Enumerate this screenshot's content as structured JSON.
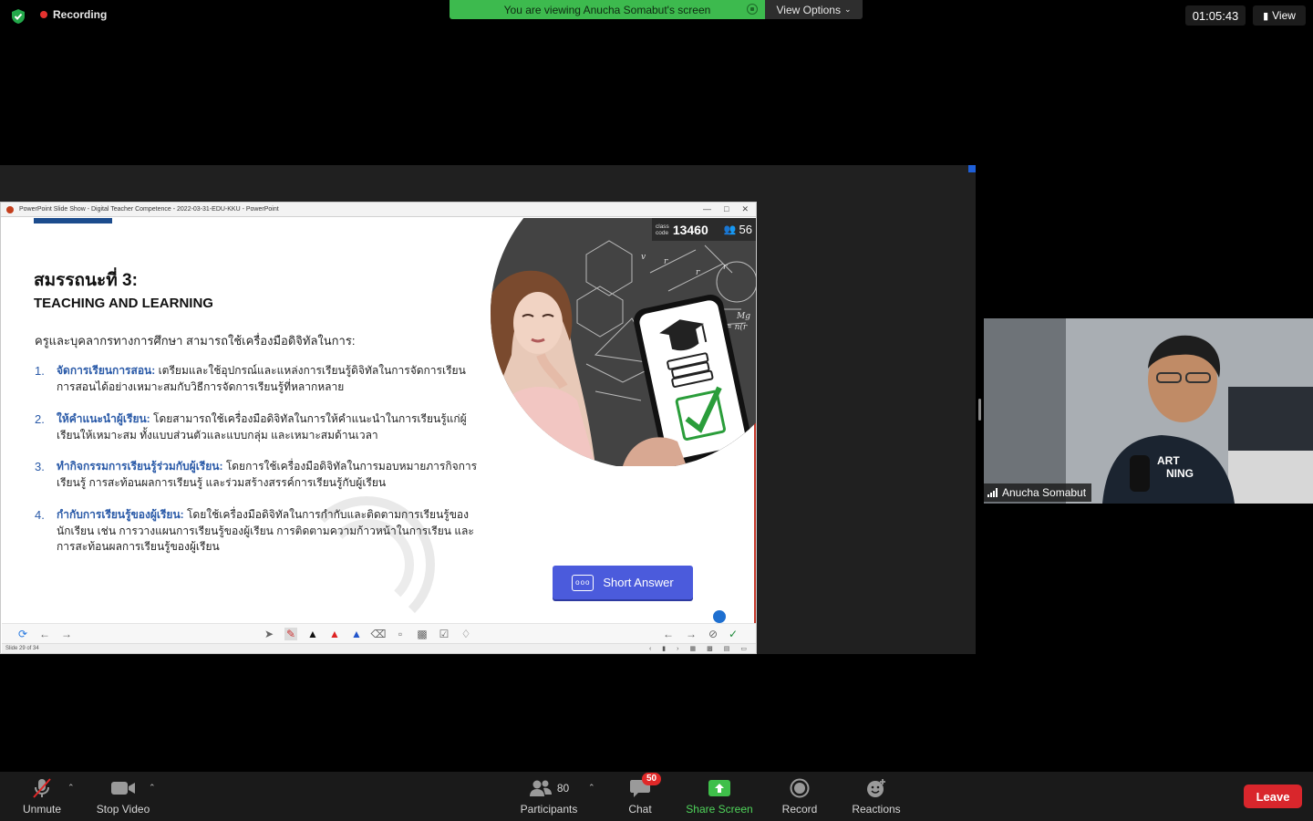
{
  "topbar": {
    "recording_label": "Recording",
    "viewing_banner": "You are viewing Anucha Somabut's screen",
    "view_options_label": "View Options",
    "timer": "01:05:43",
    "view_label": "View"
  },
  "ppt": {
    "window_title": "PowerPoint Slide Show  -  Digital Teacher Competence - 2022-03-31-EDU-KKU  -  PowerPoint",
    "status_text": "Slide 29 of 34"
  },
  "slide": {
    "title": "สมรรถนะที่ 3:",
    "subtitle": "TEACHING AND LEARNING",
    "intro": "ครูและบุคลากรทางการศึกษา สามารถใช้เครื่องมือดิจิทัลในการ:",
    "items": [
      {
        "num": "1.",
        "head": "จัดการเรียนการสอน:",
        "text": " เตรียมและใช้อุปกรณ์และแหล่งการเรียนรู้ดิจิทัลในการจัดการเรียนการสอนได้อย่างเหมาะสมกับวิธีการจัดการเรียนรู้ที่หลากหลาย"
      },
      {
        "num": "2.",
        "head": "ให้คำแนะนำผู้เรียน:",
        "text": " โดยสามารถใช้เครื่องมือดิจิทัลในการให้คำแนะนำในการเรียนรู้แก่ผู้เรียนให้เหมาะสม ทั้งแบบส่วนตัวและแบบกลุ่ม และเหมาะสมด้านเวลา"
      },
      {
        "num": "3.",
        "head": "ทำกิจกรรมการเรียนรู้ร่วมกับผู้เรียน:",
        "text": " โดยการใช้เครื่องมือดิจิทัลในการมอบหมายภารกิจการเรียนรู้ การสะท้อนผลการเรียนรู้ และร่วมสร้างสรรค์การเรียนรู้กับผู้เรียน"
      },
      {
        "num": "4.",
        "head": "กำกับการเรียนรู้ของผู้เรียน:",
        "text": " โดยใช้เครื่องมือดิจิทัลในการกำกับและติดตามการเรียนรู้ของนักเรียน เช่น การวางแผนการเรียนรู้ของผู้เรียน การติดตามความก้าวหน้าในการเรียน และการสะท้อนผลการเรียนรู้ของผู้เรียน"
      }
    ],
    "class_code_label_1": "class",
    "class_code_label_2": "code",
    "class_code": "13460",
    "participant_count": "56",
    "short_answer_label": "Short Answer"
  },
  "video": {
    "participant_name": "Anucha Somabut"
  },
  "controls": {
    "unmute": "Unmute",
    "stop_video": "Stop Video",
    "participants": "Participants",
    "participants_count": "80",
    "chat": "Chat",
    "chat_badge": "50",
    "share_screen": "Share Screen",
    "record": "Record",
    "reactions": "Reactions",
    "leave": "Leave"
  },
  "colors": {
    "banner_green": "#3dba4e",
    "share_green": "#3fbf4a",
    "leave_red": "#d9262c",
    "short_answer_blue": "#4b5bdc",
    "slide_accent_blue": "#2a5aa8"
  }
}
